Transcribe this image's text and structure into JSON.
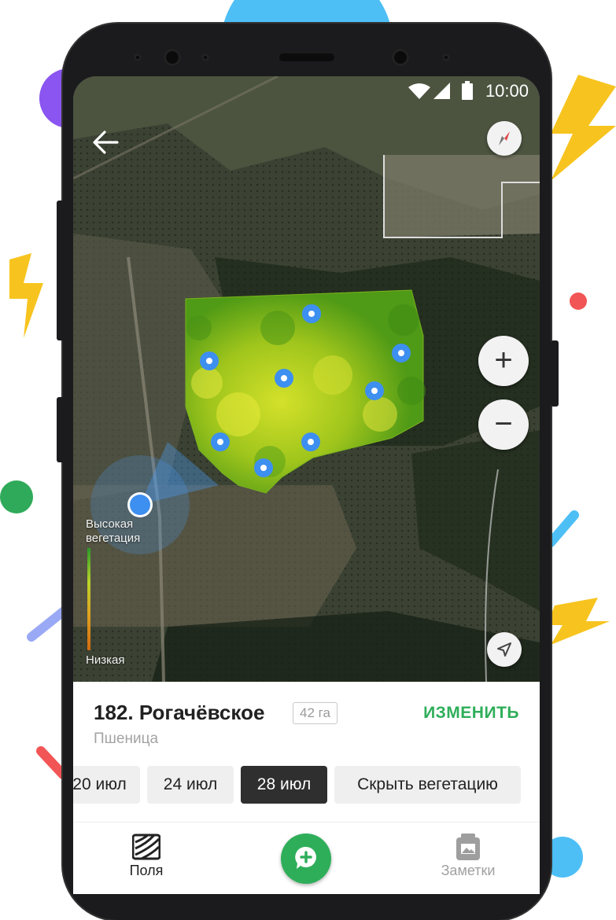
{
  "status_bar": {
    "time": "10:00"
  },
  "map": {
    "legend_high": "Высокая вегетация",
    "legend_low": "Низкая",
    "zoom_in": "+",
    "zoom_out": "−"
  },
  "field": {
    "title": "182. Рогачёвское",
    "area": "42 га",
    "crop": "Пшеница",
    "edit_label": "ИЗМЕНИТЬ"
  },
  "date_chips": [
    {
      "label": "20 июл",
      "active": false
    },
    {
      "label": "24 июл",
      "active": false
    },
    {
      "label": "28 июл",
      "active": true
    },
    {
      "label": "Скрыть вегетацию",
      "active": false
    }
  ],
  "bottom_nav": {
    "fields_label": "Поля",
    "notes_label": "Заметки"
  },
  "colors": {
    "accent_green": "#2fae5a",
    "active_chip": "#2f2f2f",
    "point_blue": "#3d8ff0"
  },
  "icons": [
    "arrow-back-icon",
    "compass-icon",
    "plus-icon",
    "minus-icon",
    "navigation-arrow-icon",
    "fields-icon",
    "add-note-icon",
    "notes-icon",
    "wifi-icon",
    "signal-icon",
    "battery-icon"
  ]
}
